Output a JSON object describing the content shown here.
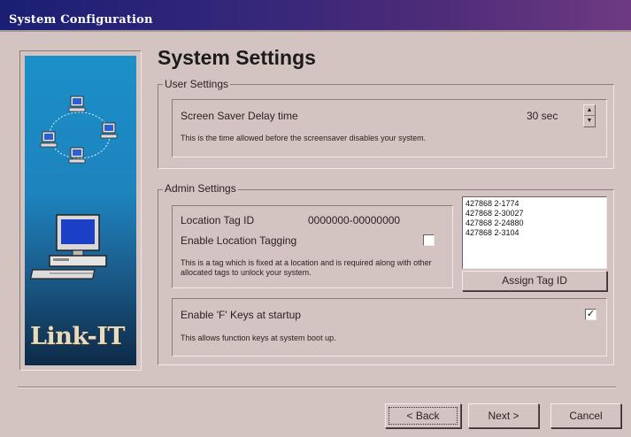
{
  "window": {
    "title": "System Configuration"
  },
  "sidebar": {
    "brand": "Link-IT",
    "network_icon": "network-computers-icon",
    "computer_icon": "desktop-computer-icon"
  },
  "page": {
    "heading": "System Settings"
  },
  "user_settings": {
    "legend": "User Settings",
    "screen_saver": {
      "label": "Screen Saver Delay time",
      "value": "30 sec",
      "description": "This is the time allowed before the screensaver disables your system."
    }
  },
  "admin_settings": {
    "legend": "Admin Settings",
    "location_tag": {
      "label": "Location Tag ID",
      "value": "0000000-00000000",
      "enable_label": "Enable Location Tagging",
      "enabled": false,
      "description": "This is a tag which is fixed at a location and is required along with other allocated tags to unlock your system."
    },
    "tag_list": [
      "427868 2-1774",
      "427868 2-30027",
      "427868 2-24880",
      "427868 2-3104"
    ],
    "assign_button": "Assign Tag ID",
    "f_keys": {
      "label": "Enable 'F' Keys at startup",
      "enabled": true,
      "description": "This allows function keys at system boot up."
    }
  },
  "footer": {
    "back_button": "< Back",
    "next_button": "Next >",
    "cancel_button": "Cancel"
  },
  "colors": {
    "dialog_bg": "#d4c4c1",
    "titlebar_start": "#1a1f73",
    "titlebar_end": "#6e3a82",
    "sidebar_top": "#1c8fc8",
    "sidebar_bottom": "#0e2a48"
  }
}
